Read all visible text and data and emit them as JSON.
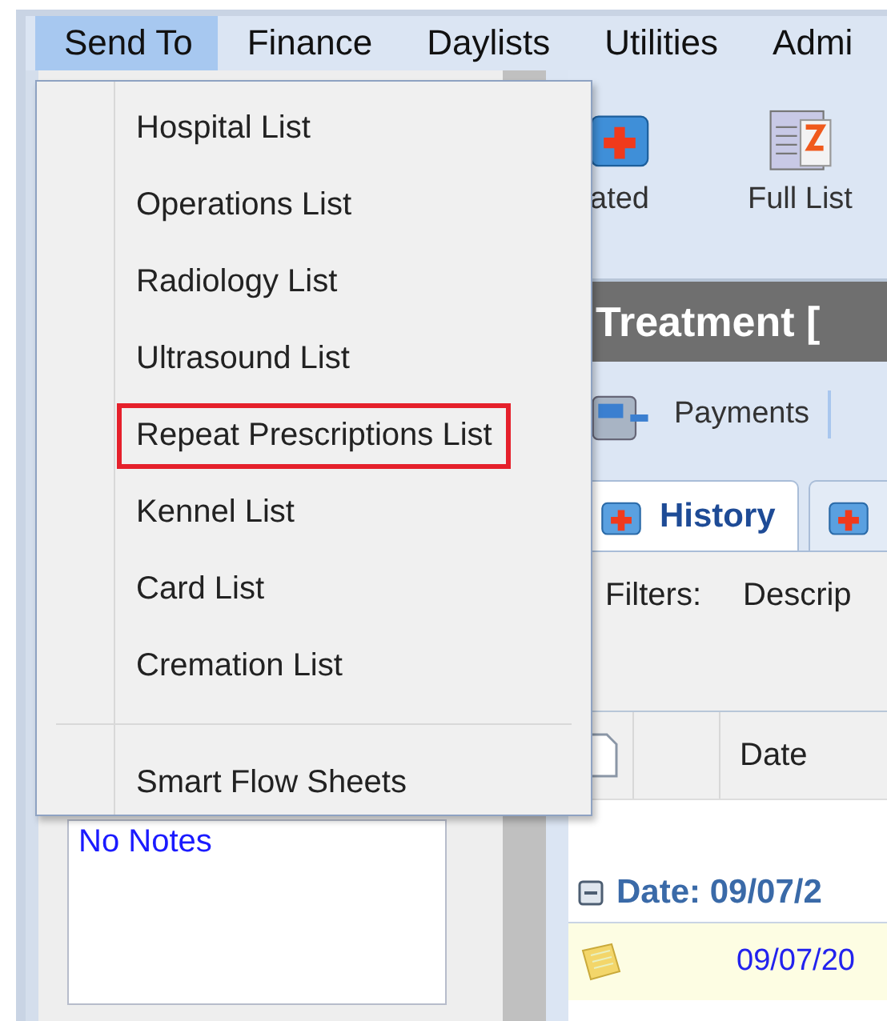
{
  "menu_bar": [
    {
      "label": "Send To",
      "selected": true
    },
    {
      "label": "Finance",
      "selected": false
    },
    {
      "label": "Daylists",
      "selected": false
    },
    {
      "label": "Utilities",
      "selected": false
    },
    {
      "label": "Admi",
      "selected": false
    }
  ],
  "send_to_menu": {
    "groups": [
      {
        "items": [
          {
            "label": "Hospital List",
            "highlighted": false
          },
          {
            "label": "Operations List",
            "highlighted": false
          },
          {
            "label": "Radiology List",
            "highlighted": false
          },
          {
            "label": "Ultrasound List",
            "highlighted": false
          },
          {
            "label": "Repeat Prescriptions List",
            "highlighted": true
          },
          {
            "label": "Kennel List",
            "highlighted": false
          },
          {
            "label": "Card List",
            "highlighted": false
          },
          {
            "label": "Cremation List",
            "highlighted": false
          }
        ]
      },
      {
        "items": [
          {
            "label": "Smart Flow Sheets",
            "highlighted": false
          }
        ]
      }
    ]
  },
  "toolbar": {
    "updated_button": "ated",
    "full_list_button": "Full List"
  },
  "title": "Treatment [",
  "actions": [
    {
      "label": "Payments"
    }
  ],
  "tabs": [
    {
      "label": "History",
      "selected": true
    },
    {
      "selected": false
    }
  ],
  "filters": {
    "label": "Filters:",
    "column_2": "Descrip"
  },
  "grid": {
    "column_3": "Date",
    "group": "Date: 09/07/2",
    "rows": [
      {
        "date": "09/07/20"
      }
    ]
  },
  "notes": {
    "text": "No Notes"
  }
}
